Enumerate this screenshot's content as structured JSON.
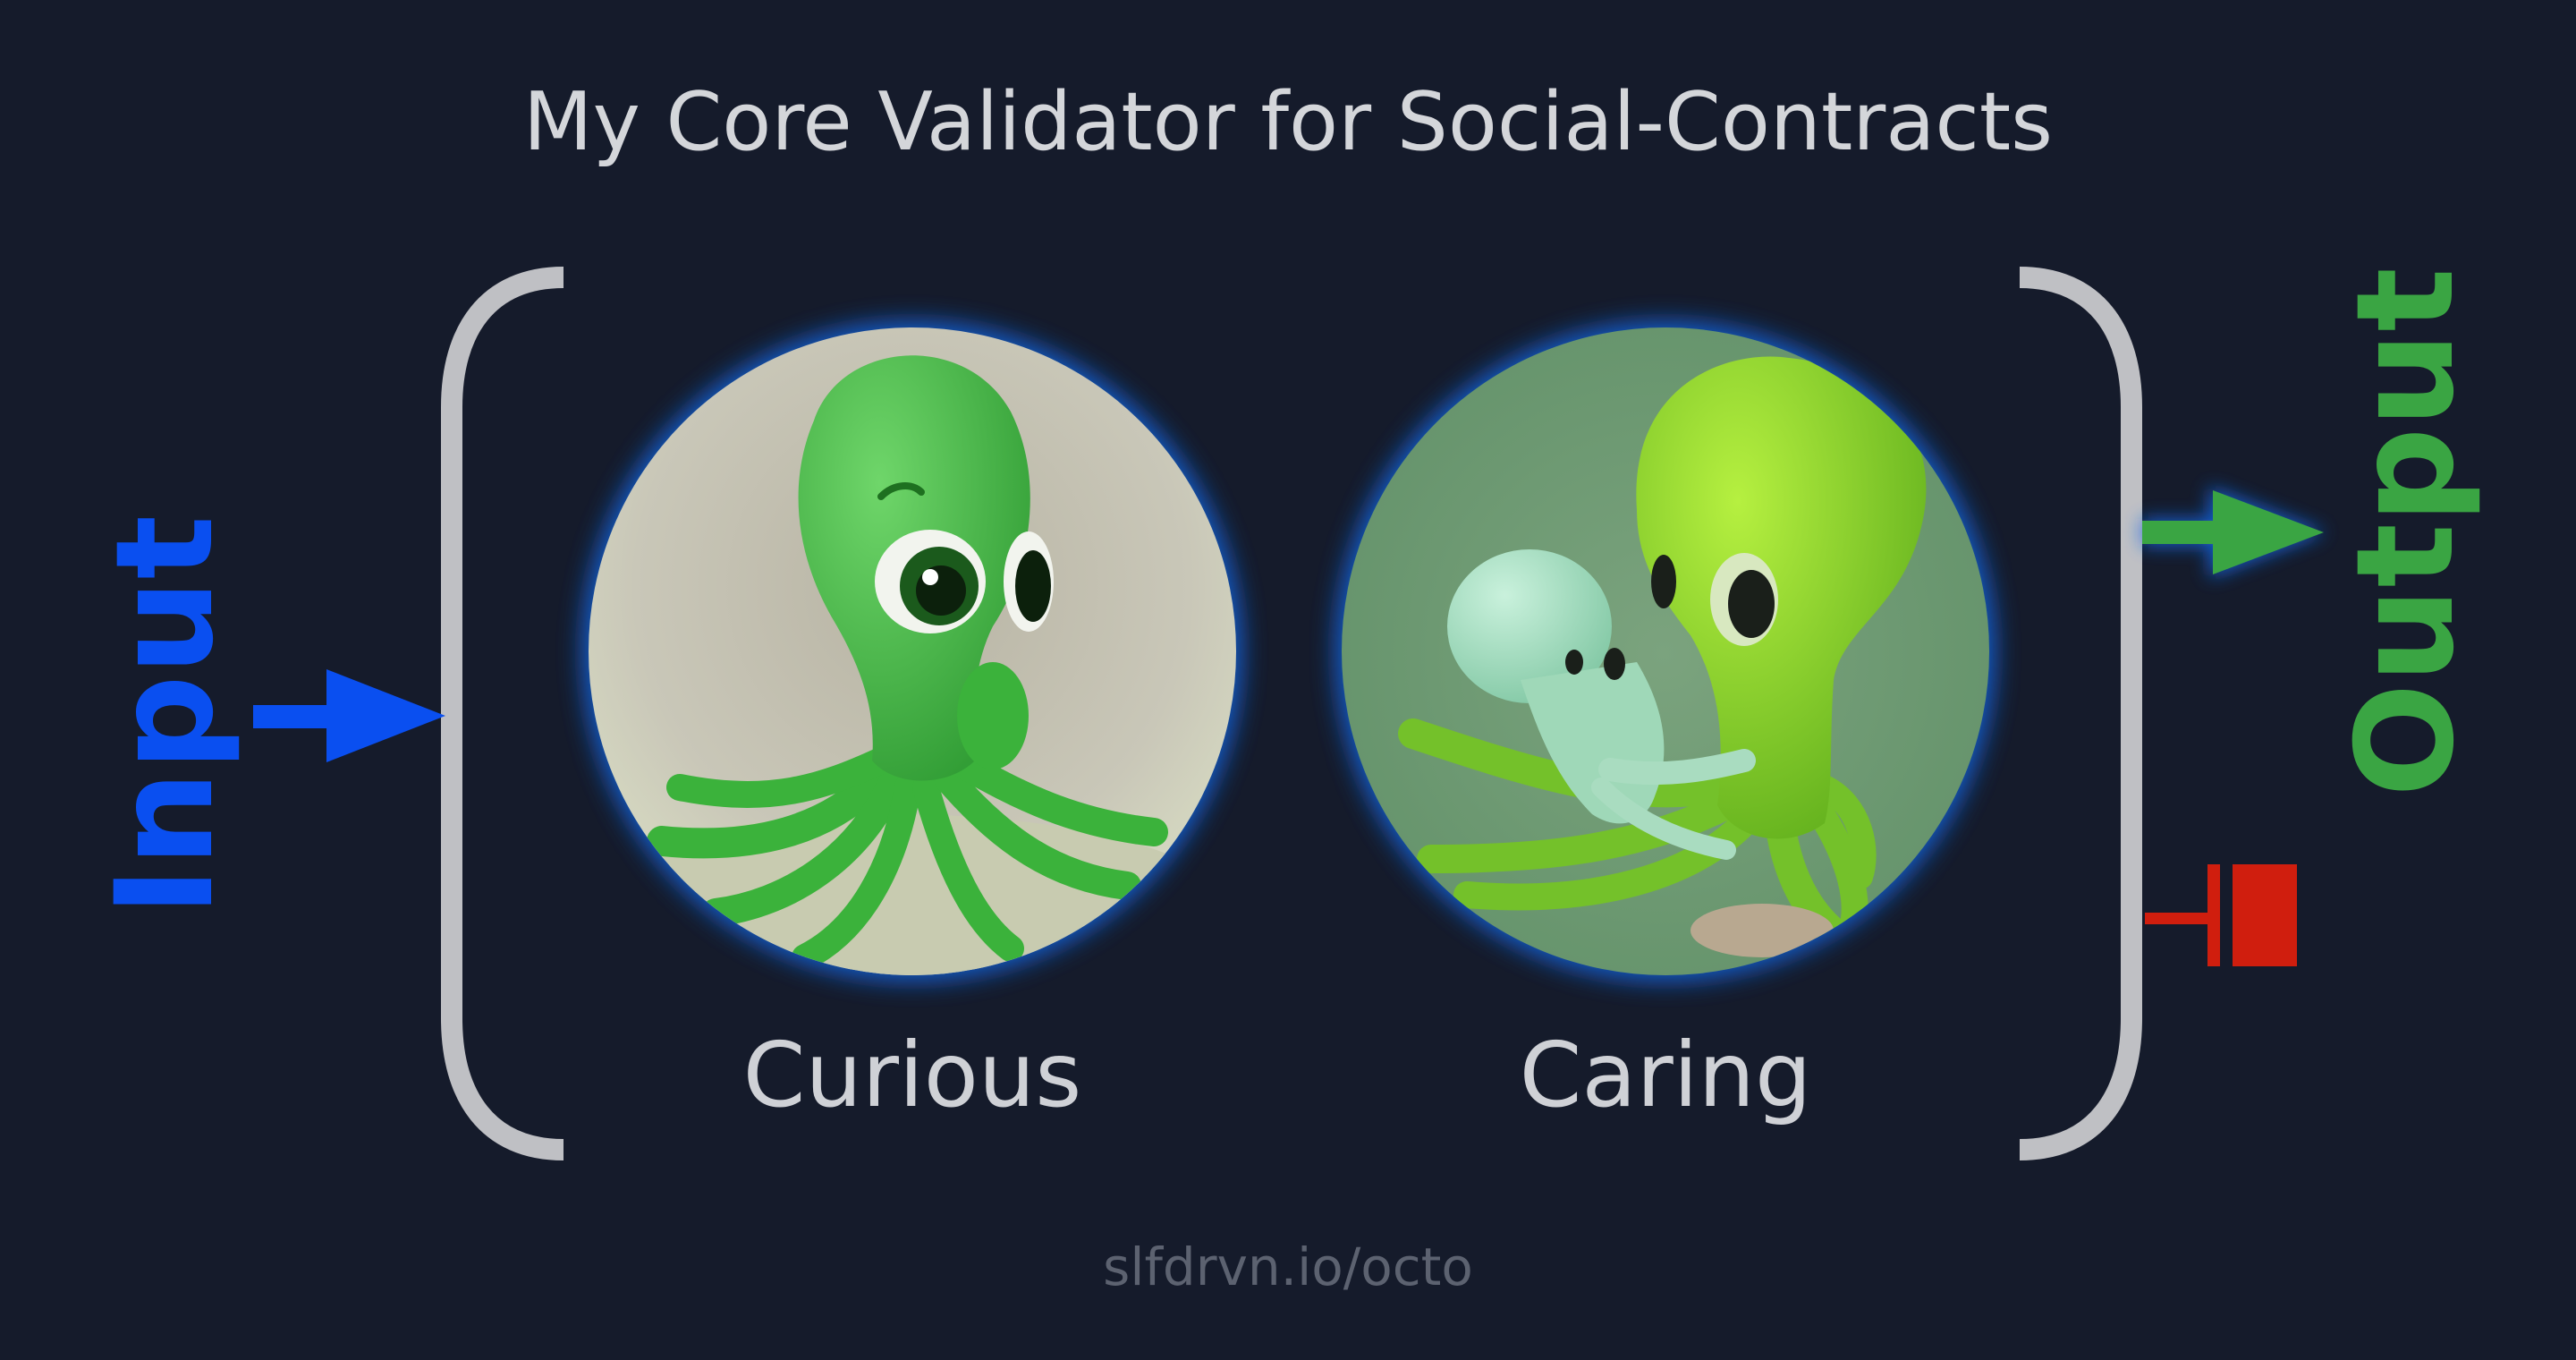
{
  "title": "My Core Validator for Social-Contracts",
  "input_label": "Input",
  "output_label": "Output",
  "traits": [
    {
      "label": "Curious"
    },
    {
      "label": "Caring"
    }
  ],
  "footer": "slfdrvn.io/octo",
  "colors": {
    "background": "#151b2b",
    "bracket": "#bfc0c4",
    "input": "#0a4ff0",
    "output": "#3aa543",
    "block": "#d01e0e",
    "glow": "#1467e6"
  }
}
